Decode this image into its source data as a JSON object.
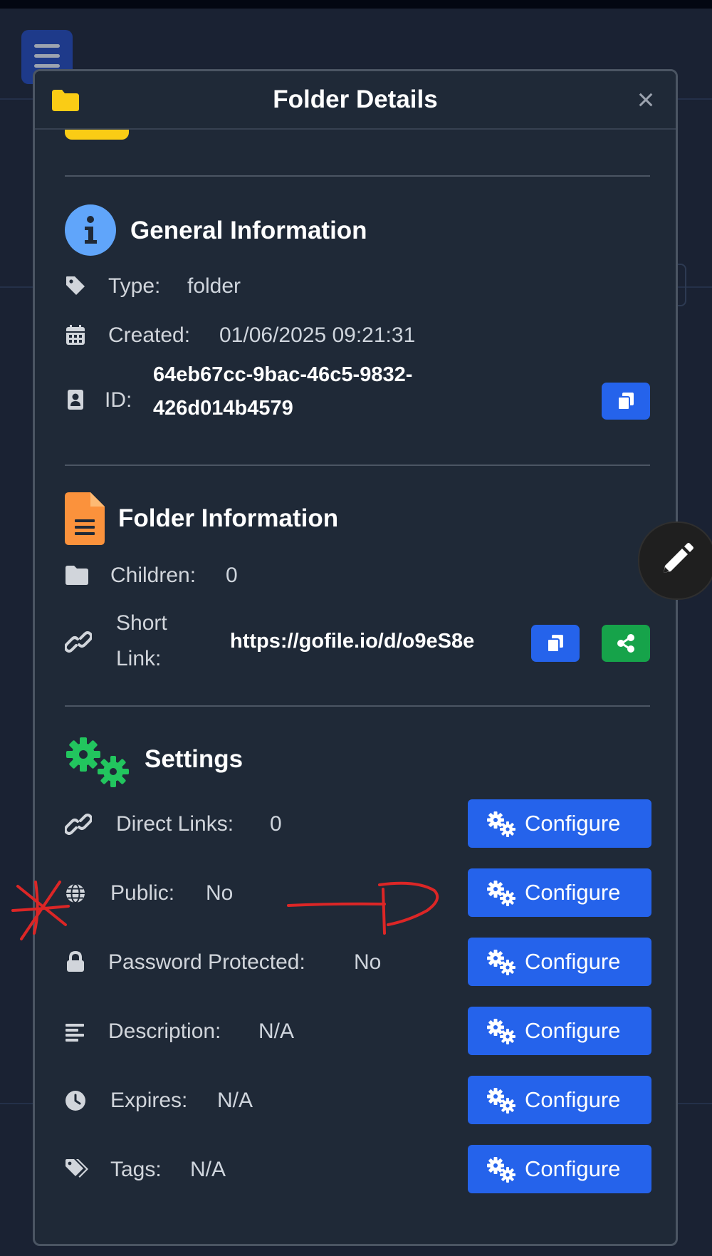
{
  "modal": {
    "title": "Folder Details",
    "close_symbol": "×"
  },
  "general": {
    "title": "General Information",
    "type_label": "Type:",
    "type_value": "folder",
    "created_label": "Created:",
    "created_value": "01/06/2025 09:21:31",
    "id_label": "ID:",
    "id_line1": "64eb67cc-9bac-46c5-9832-",
    "id_line2": "426d014b4579"
  },
  "folder_info": {
    "title": "Folder Information",
    "children_label": "Children:",
    "children_value": "0",
    "short_link_label_line1": "Short",
    "short_link_label_line2": "Link:",
    "short_link_value": "https://gofile.io/d/o9eS8e"
  },
  "settings": {
    "title": "Settings",
    "items": [
      {
        "label": "Direct Links:",
        "value": "0",
        "icon": "link-icon",
        "button": "Configure"
      },
      {
        "label": "Public:",
        "value": "No",
        "icon": "globe-icon",
        "button": "Configure"
      },
      {
        "label": "Password Protected:",
        "value": "No",
        "icon": "lock-icon",
        "button": "Configure"
      },
      {
        "label": "Description:",
        "value": "N/A",
        "icon": "align-left-icon",
        "button": "Configure"
      },
      {
        "label": "Expires:",
        "value": "N/A",
        "icon": "clock-icon",
        "button": "Configure"
      },
      {
        "label": "Tags:",
        "value": "N/A",
        "icon": "tags-icon",
        "button": "Configure"
      }
    ]
  },
  "colors": {
    "modal_bg": "#1f2937",
    "accent_blue": "#2563eb",
    "share_green": "#16a34a",
    "info_icon": "#60a5fa",
    "file_icon": "#fb923c",
    "folder_icon": "#facc15",
    "settings_icon": "#22c55e",
    "annotation_red": "#dc2626"
  }
}
